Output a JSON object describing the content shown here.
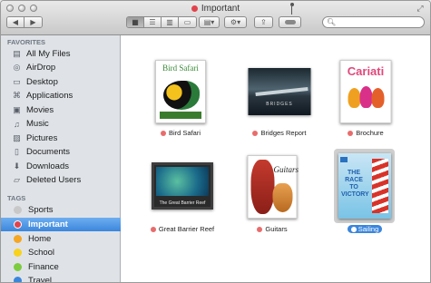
{
  "window": {
    "title": "Important",
    "title_tag_color": "#e0434c"
  },
  "toolbar": {
    "back_icon": "chevron-left-icon",
    "forward_icon": "chevron-right-icon",
    "view_icons": [
      "grid-view-icon",
      "list-view-icon",
      "column-view-icon",
      "coverflow-view-icon"
    ],
    "arrange_icon": "arrange-icon",
    "action_icon": "gear-icon",
    "share_icon": "share-icon",
    "tags_icon": "tag-icon",
    "search": {
      "placeholder": "",
      "value": ""
    }
  },
  "sidebar": {
    "favorites_title": "FAVORITES",
    "favorites": [
      {
        "label": "All My Files",
        "icon": "all-files-icon"
      },
      {
        "label": "AirDrop",
        "icon": "airdrop-icon"
      },
      {
        "label": "Desktop",
        "icon": "desktop-icon"
      },
      {
        "label": "Applications",
        "icon": "applications-icon"
      },
      {
        "label": "Movies",
        "icon": "movies-icon"
      },
      {
        "label": "Music",
        "icon": "music-icon"
      },
      {
        "label": "Pictures",
        "icon": "pictures-icon"
      },
      {
        "label": "Documents",
        "icon": "documents-icon"
      },
      {
        "label": "Downloads",
        "icon": "downloads-icon"
      },
      {
        "label": "Deleted Users",
        "icon": "folder-icon"
      }
    ],
    "tags_title": "TAGS",
    "tags": [
      {
        "label": "Sports",
        "color": "#c8c8c8"
      },
      {
        "label": "Important",
        "color": "#e0434c",
        "selected": true
      },
      {
        "label": "Home",
        "color": "#f5a623"
      },
      {
        "label": "School",
        "color": "#f8d21c"
      },
      {
        "label": "Finance",
        "color": "#7ccc3f"
      },
      {
        "label": "Travel",
        "color": "#3b86dc"
      }
    ]
  },
  "files": [
    {
      "name": "Bird Safari",
      "tag_color": "#e86c6c",
      "cover_title": "Bird Safari"
    },
    {
      "name": "Bridges Report",
      "tag_color": "#e86c6c",
      "cover_title": "BRIDGES"
    },
    {
      "name": "Brochure",
      "tag_color": "#e86c6c",
      "cover_title": "Cariati"
    },
    {
      "name": "Great Barrier Reef",
      "tag_color": "#e86c6c",
      "cover_title": "The Great Barrier Reef"
    },
    {
      "name": "Guitars",
      "tag_color": "#e86c6c",
      "cover_title": "Guitars"
    },
    {
      "name": "Sailing",
      "tag_color": "#3b86dc",
      "cover_title": "THE RACE TO VICTORY",
      "selected": true
    }
  ]
}
